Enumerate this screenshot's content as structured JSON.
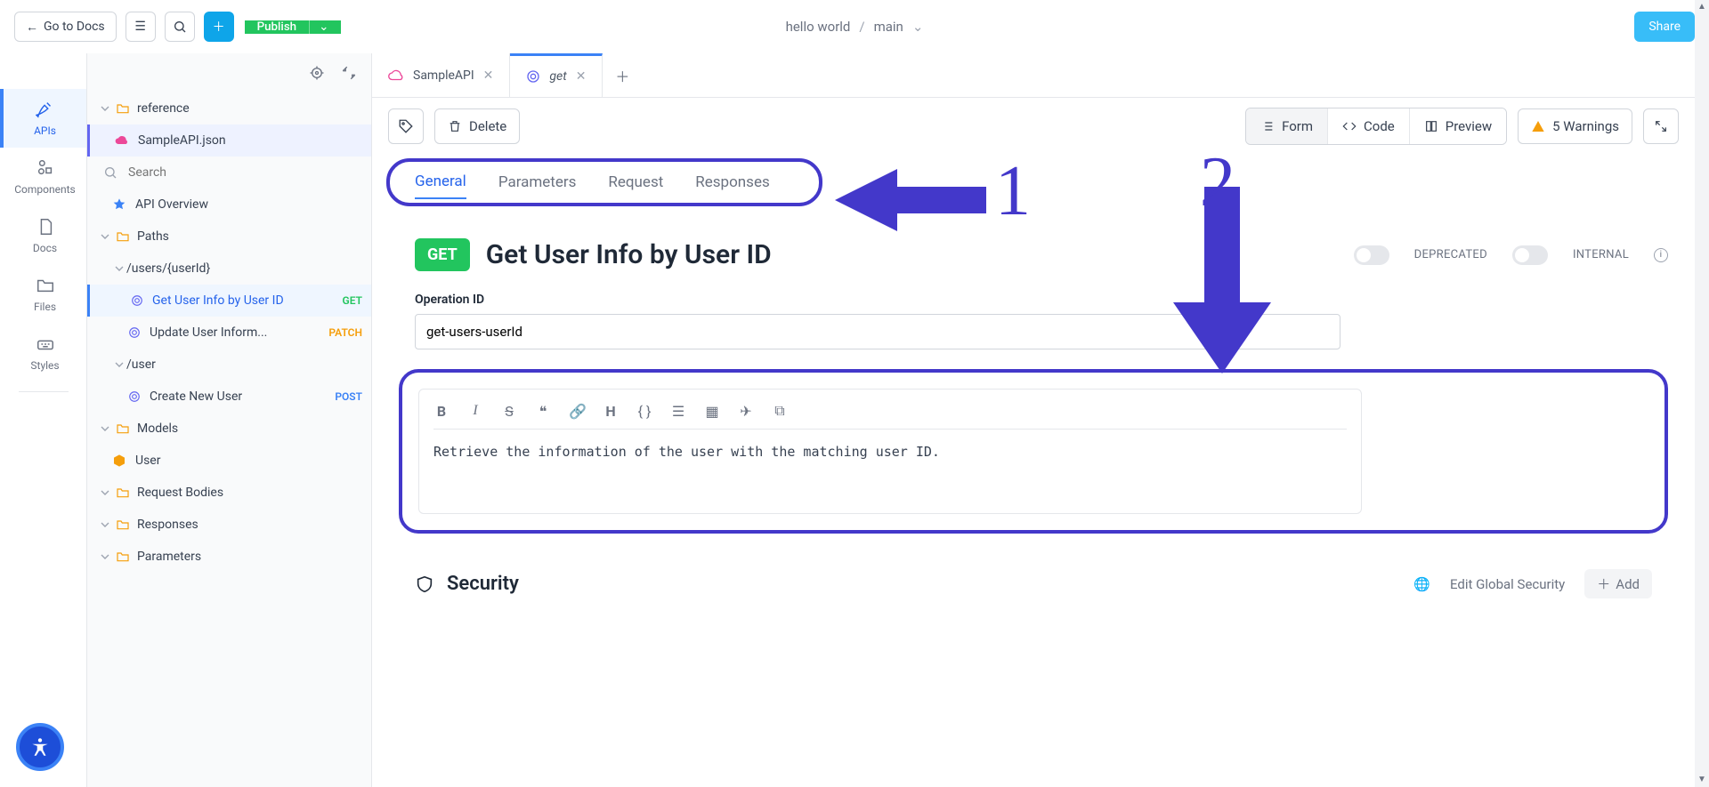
{
  "topbar": {
    "go_to_docs": "Go to Docs",
    "publish": "Publish",
    "project": "hello world",
    "branch": "main",
    "share": "Share"
  },
  "rail": {
    "apis": "APIs",
    "components": "Components",
    "docs": "Docs",
    "files": "Files",
    "styles": "Styles"
  },
  "sidebar": {
    "reference": "reference",
    "sample_file": "SampleAPI.json",
    "search_placeholder": "Search",
    "api_overview": "API Overview",
    "paths": "Paths",
    "path_users_userid": "/users/{userId}",
    "op_get_user": "Get User Info by User ID",
    "op_get_method": "GET",
    "op_patch_user": "Update User Inform...",
    "op_patch_method": "PATCH",
    "path_user": "/user",
    "op_create_user": "Create New User",
    "op_post_method": "POST",
    "models": "Models",
    "model_user": "User",
    "request_bodies": "Request Bodies",
    "responses": "Responses",
    "parameters": "Parameters"
  },
  "tabs": {
    "t1": "SampleAPI",
    "t2": "get"
  },
  "toolbar": {
    "delete": "Delete",
    "form": "Form",
    "code": "Code",
    "preview": "Preview",
    "warnings": "5 Warnings"
  },
  "form_tabs": {
    "general": "General",
    "parameters": "Parameters",
    "request": "Request",
    "responses": "Responses"
  },
  "op": {
    "badge": "GET",
    "title": "Get User Info by User ID",
    "deprecated_label": "DEPRECATED",
    "internal_label": "INTERNAL"
  },
  "opid": {
    "label": "Operation ID",
    "value": "get-users-userId"
  },
  "desc": {
    "body": "Retrieve the information of the user with the matching user ID."
  },
  "security": {
    "title": "Security",
    "edit_global": "Edit Global Security",
    "add": "Add"
  },
  "annotations": {
    "one": "1",
    "two": "2"
  }
}
